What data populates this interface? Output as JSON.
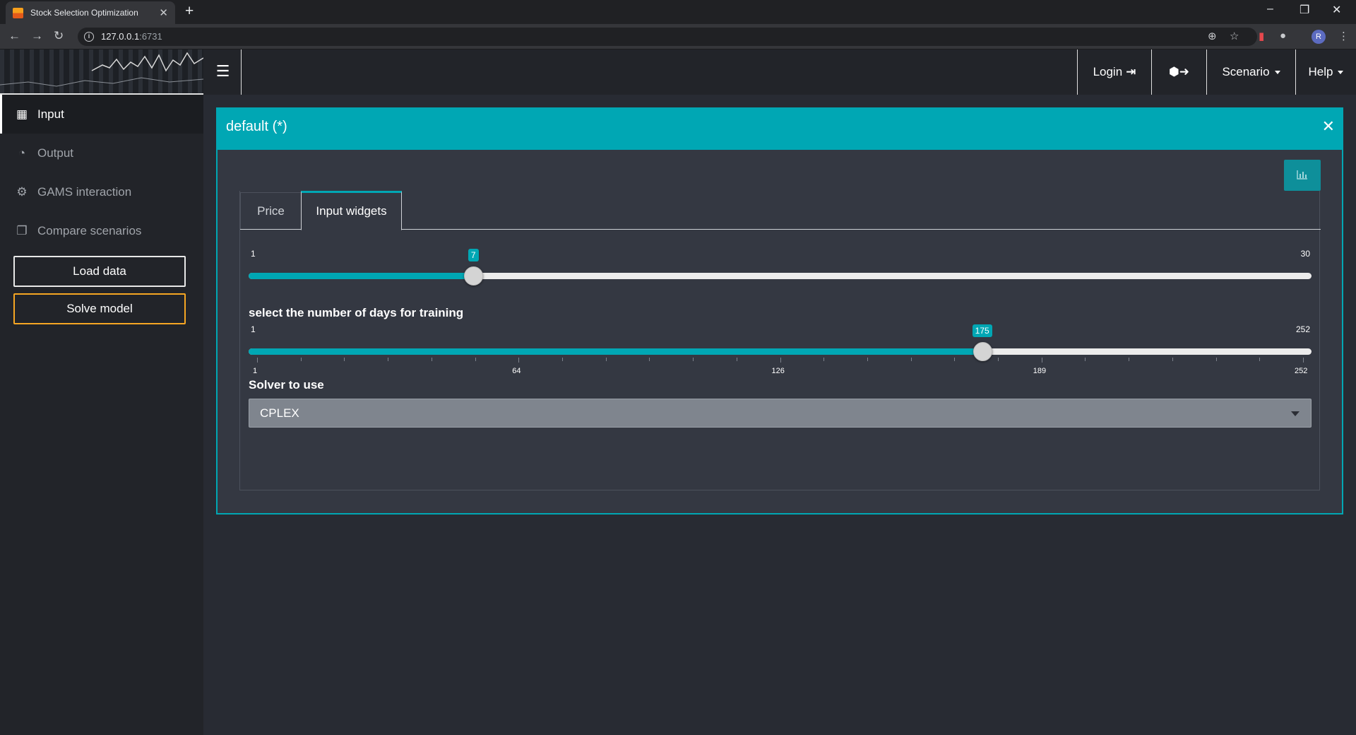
{
  "browser": {
    "tab_title": "Stock Selection Optimization",
    "url_host": "127.0.0.1",
    "url_port": ":6731"
  },
  "header": {
    "login_label": "Login",
    "scenario_label": "Scenario",
    "help_label": "Help"
  },
  "sidebar": {
    "items": [
      {
        "label": "Input",
        "icon": "grid-icon"
      },
      {
        "label": "Output",
        "icon": "dashboard-icon"
      },
      {
        "label": "GAMS interaction",
        "icon": "gear-icon"
      },
      {
        "label": "Compare scenarios",
        "icon": "copy-icon"
      }
    ],
    "load_label": "Load data",
    "solve_label": "Solve model"
  },
  "box": {
    "title": "default (*)",
    "tabs": [
      {
        "label": "Price"
      },
      {
        "label": "Input widgets"
      }
    ],
    "slider1": {
      "min": "1",
      "max": "30",
      "value": "7",
      "min_num": 1,
      "max_num": 30,
      "value_num": 7
    },
    "slider2": {
      "label": "select the number of days for training",
      "min": "1",
      "max": "252",
      "value": "175",
      "min_num": 1,
      "max_num": 252,
      "value_num": 175,
      "tick_labels": [
        "1",
        "64",
        "126",
        "189",
        "252"
      ]
    },
    "solver": {
      "label": "Solver to use",
      "value": "CPLEX"
    }
  },
  "colors": {
    "accent": "#00a7b4",
    "solve_border": "#f6a623",
    "background": "#282b33",
    "sidebar": "#222429"
  }
}
